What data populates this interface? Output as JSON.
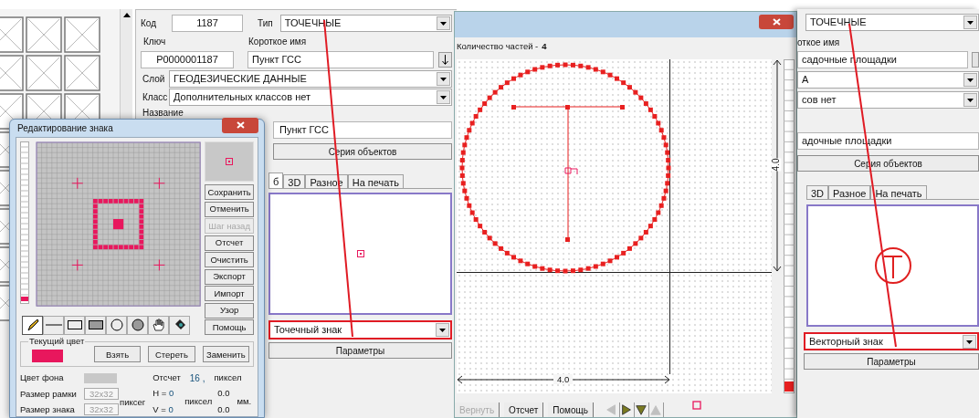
{
  "object_form": {
    "code": {
      "label": "Код",
      "value": "1187"
    },
    "type": {
      "label": "Тип",
      "value": "ТОЧЕЧНЫЕ"
    },
    "key": {
      "label": "Ключ",
      "value": "P0000001187"
    },
    "short_name": {
      "label": "Короткое имя",
      "value": "Пункт ГСС"
    },
    "layer": {
      "label": "Слой",
      "value": "ГЕОДЕЗИЧЕСКИЕ ДАННЫЕ"
    },
    "class": {
      "label": "Класс",
      "value": "Дополнительных классов нет"
    },
    "name": {
      "label": "Название",
      "value": "Пункт ГСС"
    },
    "series_button": "Серия объектов",
    "tabs": [
      {
        "label": "б",
        "selected": true
      },
      {
        "label": "3D",
        "selected": false
      },
      {
        "label": "Разное",
        "selected": false
      },
      {
        "label": "На печать",
        "selected": false
      }
    ],
    "sign_type": {
      "value": "Точечный знак",
      "highlighted": true
    },
    "parameters_button": "Параметры"
  },
  "sign_editor": {
    "title": "Редактирование знака",
    "buttons": [
      {
        "label": "Сохранить",
        "disabled": false
      },
      {
        "label": "Отменить",
        "disabled": false
      },
      {
        "label": "Шаг назад",
        "disabled": true
      },
      {
        "label": "Отсчет",
        "disabled": false
      },
      {
        "label": "Очистить",
        "disabled": false
      },
      {
        "label": "Экспорт",
        "disabled": false
      },
      {
        "label": "Импорт",
        "disabled": false
      },
      {
        "label": "Узор",
        "disabled": false
      },
      {
        "label": "Помощь",
        "disabled": false
      }
    ],
    "tools": [
      {
        "kind": "pencil",
        "selected": true
      },
      {
        "kind": "line",
        "selected": false
      },
      {
        "kind": "rect",
        "selected": false
      },
      {
        "kind": "filled_rect",
        "selected": false
      },
      {
        "kind": "circle",
        "selected": false
      },
      {
        "kind": "filled_circle",
        "selected": false
      },
      {
        "kind": "hand",
        "selected": false
      },
      {
        "kind": "fill",
        "selected": false
      }
    ],
    "current_color": {
      "legend": "Текущий цвет",
      "color": "#e8175d"
    },
    "color_buttons": [
      "Взять",
      "Стереть",
      "Заменить"
    ],
    "background_color": {
      "label": "Цвет фона",
      "color": "#c8c8c8"
    },
    "frame_size": {
      "label": "Размер рамки",
      "value": "32x32",
      "disabled": true
    },
    "sign_size": {
      "label": "Размер знака",
      "value": "32x32",
      "disabled": true
    },
    "size_unit": "пиксег",
    "origin": {
      "label": "Отсчет",
      "value": "16 ,",
      "unit": "пиксел"
    },
    "h": {
      "label": "H =",
      "value": "0"
    },
    "v": {
      "label": "V =",
      "value": "0"
    },
    "hv_unit": "пиксел",
    "mm_values": [
      "0.0",
      "0.0"
    ],
    "mm_unit": "мм."
  },
  "vector_editor": {
    "parts_label": "Количество частей -",
    "parts_count": "4",
    "width_dimension": "4.0",
    "height_dimension": "4.0",
    "buttons": [
      {
        "label": "Вернуть",
        "disabled": true
      },
      {
        "label": "Отсчет",
        "disabled": false
      },
      {
        "label": "Помощь",
        "disabled": false
      }
    ],
    "nav_buttons": [
      {
        "kind": "left",
        "disabled": true
      },
      {
        "kind": "right",
        "disabled": false
      },
      {
        "kind": "down",
        "disabled": false
      },
      {
        "kind": "up",
        "disabled": true
      }
    ]
  },
  "vector_form": {
    "type_value": "ТОЧЕЧНЫЕ",
    "short_name_label": "откое имя",
    "short_name_value": "садочные площадки",
    "layer_value": "А",
    "class_value": "сов нет",
    "name_value": "адочные площадки",
    "series_button": "Серия объектов",
    "tabs": [
      {
        "label": "3D",
        "selected": false
      },
      {
        "label": "Разное",
        "selected": false
      },
      {
        "label": "На печать",
        "selected": false
      }
    ],
    "sign_type": {
      "value": "Векторный знак",
      "highlighted": true
    },
    "parameters_button": "Параметры"
  }
}
